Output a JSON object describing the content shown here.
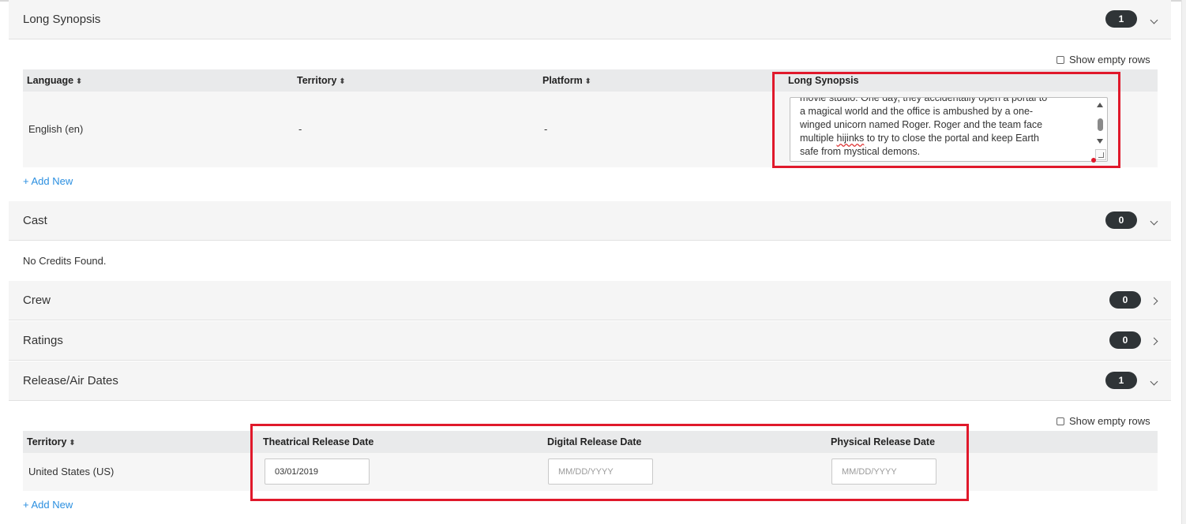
{
  "sections": {
    "long_synopsis": {
      "title": "Long Synopsis",
      "count": "1"
    },
    "cast": {
      "title": "Cast",
      "count": "0",
      "empty_message": "No Credits Found."
    },
    "crew": {
      "title": "Crew",
      "count": "0"
    },
    "ratings": {
      "title": "Ratings",
      "count": "0"
    },
    "release_dates": {
      "title": "Release/Air Dates",
      "count": "1"
    }
  },
  "synopsis_table": {
    "show_empty_rows": "Show empty rows",
    "headers": {
      "language": "Language",
      "territory": "Territory",
      "platform": "Platform",
      "long_synopsis": "Long Synopsis"
    },
    "row": {
      "language": "English (en)",
      "territory": "-",
      "platform": "-",
      "text_line0": "movie studio. One day, they accidentally open a portal to",
      "text_line1": "a magical world and the office is ambushed by a one-",
      "text_line2": "winged unicorn named Roger. Roger and the team face",
      "text_line3a": "multiple ",
      "text_line3b": "hijinks",
      "text_line3c": " to try to close the portal and keep Earth",
      "text_line4": "safe from mystical demons."
    },
    "add_new": "+ Add New"
  },
  "release_table": {
    "show_empty_rows": "Show empty rows",
    "headers": {
      "territory": "Territory",
      "theatrical": "Theatrical Release Date",
      "digital": "Digital Release Date",
      "physical": "Physical Release Date"
    },
    "row": {
      "territory": "United States (US)",
      "theatrical_value": "03/01/2019",
      "digital_placeholder": "MM/DD/YYYY",
      "physical_placeholder": "MM/DD/YYYY"
    },
    "add_new": "+ Add New"
  },
  "colors": {
    "highlight": "#e0192b",
    "link": "#2b8fe0",
    "badge": "#2f3437"
  }
}
